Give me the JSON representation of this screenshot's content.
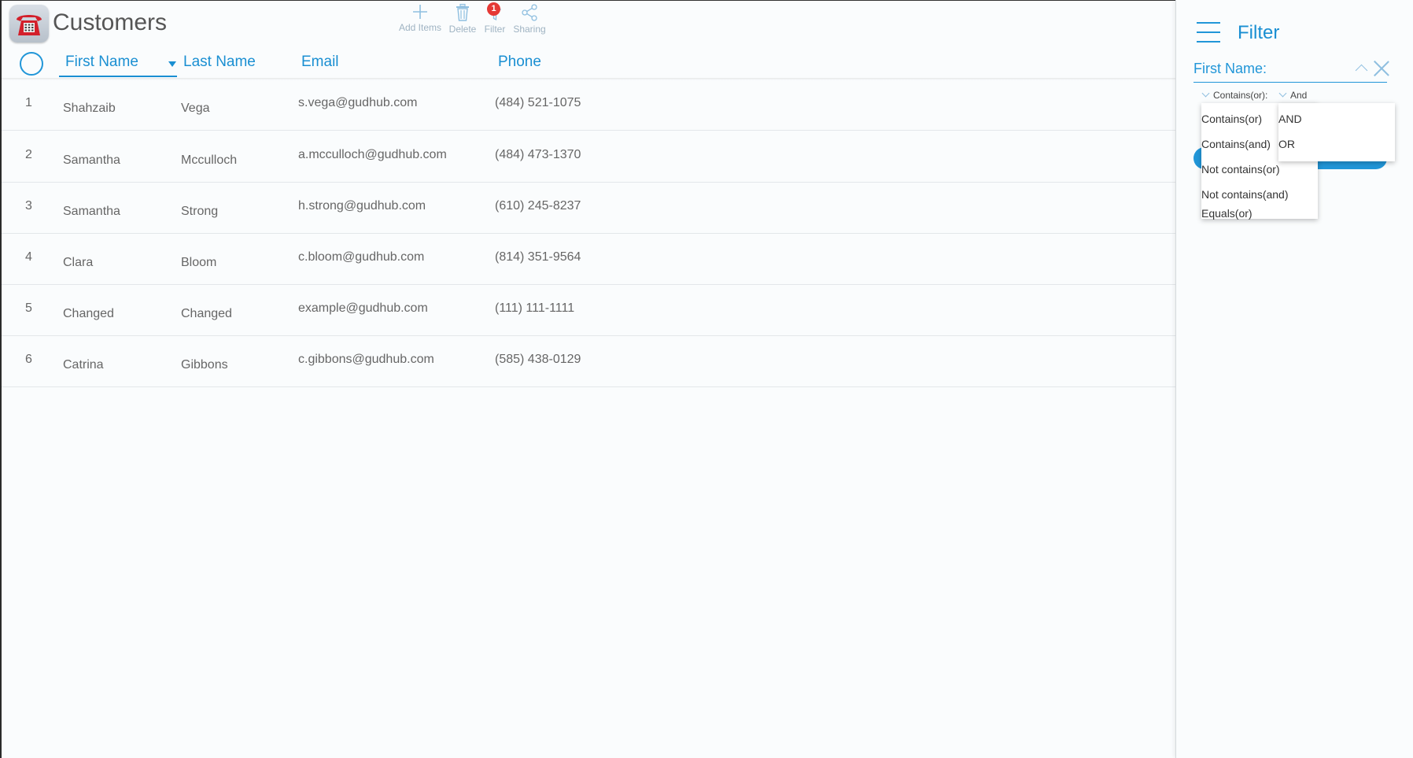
{
  "header": {
    "title": "Customers",
    "app_icon": "telephone-icon",
    "toolbar": {
      "add_label": "Add Items",
      "delete_label": "Delete",
      "filter_label": "Filter",
      "filter_badge": "1",
      "sharing_label": "Sharing"
    }
  },
  "table": {
    "columns": {
      "first_name": "First Name",
      "last_name": "Last Name",
      "email": "Email",
      "phone": "Phone"
    },
    "sort_column": "First Name",
    "rows": [
      {
        "num": "1",
        "first": "Shahzaib",
        "last": "Vega",
        "email": "s.vega@gudhub.com",
        "phone": "(484) 521-1075"
      },
      {
        "num": "2",
        "first": "Samantha",
        "last": "Mcculloch",
        "email": "a.mcculloch@gudhub.com",
        "phone": "(484) 473-1370"
      },
      {
        "num": "3",
        "first": "Samantha",
        "last": "Strong",
        "email": "h.strong@gudhub.com",
        "phone": "(610) 245-8237"
      },
      {
        "num": "4",
        "first": "Clara",
        "last": "Bloom",
        "email": "c.bloom@gudhub.com",
        "phone": "(814) 351-9564"
      },
      {
        "num": "5",
        "first": "Changed",
        "last": "Changed",
        "email": "example@gudhub.com",
        "phone": "(111) 111-1111"
      },
      {
        "num": "6",
        "first": "Catrina",
        "last": "Gibbons",
        "email": "c.gibbons@gudhub.com",
        "phone": "(585) 438-0129"
      }
    ]
  },
  "filter_panel": {
    "title": "Filter",
    "field_label": "First Name:",
    "mode_selected": "Contains(or):",
    "logic_selected": "And",
    "mode_options": [
      "Contains(or)",
      "Contains(and)",
      "Not contains(or)",
      "Not contains(and)",
      "Equals(or)"
    ],
    "logic_options": [
      "AND",
      "OR"
    ]
  },
  "colors": {
    "accent": "#2196d8",
    "badge": "#e53935",
    "text": "#666666"
  }
}
